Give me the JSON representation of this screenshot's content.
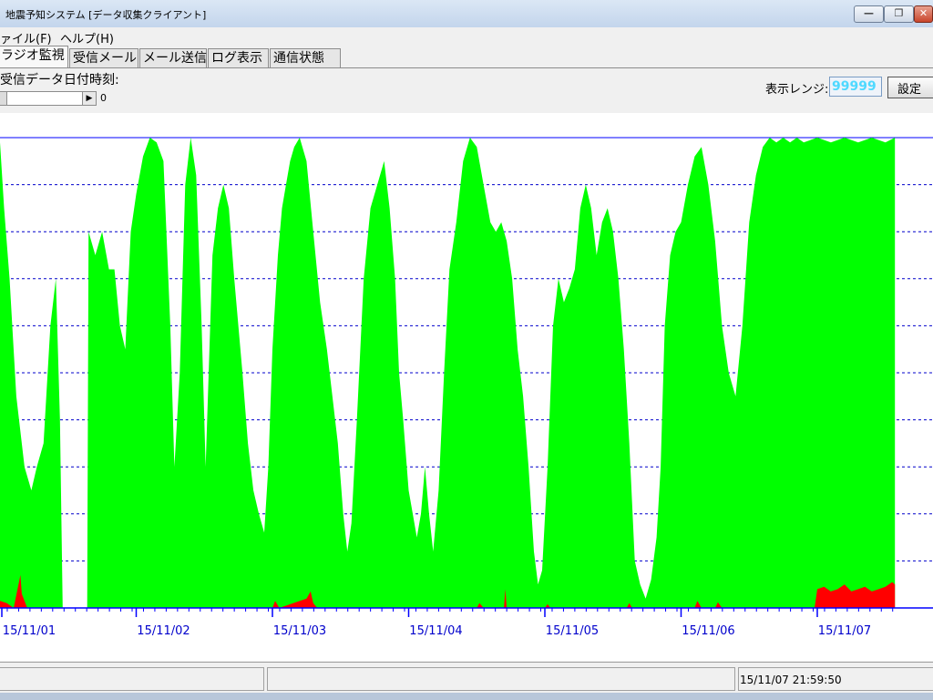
{
  "window": {
    "title": "地震予知システム [データ収集クライアント]",
    "minimize_glyph": "—",
    "restore_glyph": "❐",
    "close_glyph": "✕"
  },
  "menu": {
    "file": "ァイル(F)",
    "help": "ヘルプ(H)"
  },
  "tabs": [
    {
      "label": "ラジオ監視",
      "active": true
    },
    {
      "label": "受信メール",
      "active": false
    },
    {
      "label": "メール送信",
      "active": false
    },
    {
      "label": "ログ表示",
      "active": false
    },
    {
      "label": "通信状態",
      "active": false
    }
  ],
  "controls": {
    "receive_datetime_label": "受信データ日付時刻:",
    "slider_value": "0",
    "range_label": "表示レンジ:",
    "range_value": "99999",
    "set_button": "設定"
  },
  "colors": {
    "signal": "#00ff00",
    "alert": "#ff0000",
    "axis": "#0000ff",
    "grid": "#0000cc"
  },
  "chart_data": {
    "type": "area",
    "x_tick_labels": [
      "15/11/01",
      "15/11/02",
      "15/11/03",
      "15/11/04",
      "15/11/05",
      "15/11/06",
      "15/11/07"
    ],
    "gridline_count": 9,
    "xlim_days": [
      0.97,
      7.57
    ],
    "green_series": [
      [
        0.97,
        0.96
      ],
      [
        1.0,
        0.99
      ],
      [
        1.03,
        0.85
      ],
      [
        1.07,
        0.7
      ],
      [
        1.12,
        0.45
      ],
      [
        1.18,
        0.3
      ],
      [
        1.23,
        0.25
      ],
      [
        1.27,
        0.3
      ],
      [
        1.32,
        0.35
      ],
      [
        1.37,
        0.6
      ],
      [
        1.41,
        0.7
      ],
      [
        1.44,
        0.4
      ],
      [
        1.46,
        0.0
      ],
      [
        1.64,
        0.0
      ],
      [
        1.65,
        0.8
      ],
      [
        1.7,
        0.75
      ],
      [
        1.75,
        0.8
      ],
      [
        1.8,
        0.72
      ],
      [
        1.84,
        0.72
      ],
      [
        1.88,
        0.6
      ],
      [
        1.92,
        0.55
      ],
      [
        1.96,
        0.8
      ],
      [
        2.0,
        0.88
      ],
      [
        2.05,
        0.96
      ],
      [
        2.1,
        1.0
      ],
      [
        2.15,
        0.99
      ],
      [
        2.2,
        0.95
      ],
      [
        2.25,
        0.6
      ],
      [
        2.28,
        0.3
      ],
      [
        2.32,
        0.5
      ],
      [
        2.36,
        0.9
      ],
      [
        2.4,
        1.0
      ],
      [
        2.44,
        0.92
      ],
      [
        2.48,
        0.6
      ],
      [
        2.51,
        0.3
      ],
      [
        2.56,
        0.75
      ],
      [
        2.6,
        0.85
      ],
      [
        2.64,
        0.9
      ],
      [
        2.68,
        0.85
      ],
      [
        2.72,
        0.7
      ],
      [
        2.78,
        0.5
      ],
      [
        2.82,
        0.35
      ],
      [
        2.86,
        0.25
      ],
      [
        2.9,
        0.2
      ],
      [
        2.94,
        0.16
      ],
      [
        2.97,
        0.3
      ],
      [
        3.0,
        0.55
      ],
      [
        3.04,
        0.75
      ],
      [
        3.07,
        0.85
      ],
      [
        3.1,
        0.9
      ],
      [
        3.13,
        0.95
      ],
      [
        3.16,
        0.98
      ],
      [
        3.2,
        1.0
      ],
      [
        3.25,
        0.95
      ],
      [
        3.3,
        0.8
      ],
      [
        3.35,
        0.65
      ],
      [
        3.4,
        0.55
      ],
      [
        3.44,
        0.45
      ],
      [
        3.48,
        0.35
      ],
      [
        3.52,
        0.2
      ],
      [
        3.55,
        0.12
      ],
      [
        3.58,
        0.18
      ],
      [
        3.62,
        0.4
      ],
      [
        3.67,
        0.7
      ],
      [
        3.72,
        0.85
      ],
      [
        3.77,
        0.9
      ],
      [
        3.82,
        0.95
      ],
      [
        3.86,
        0.85
      ],
      [
        3.9,
        0.7
      ],
      [
        3.93,
        0.5
      ],
      [
        3.96,
        0.4
      ],
      [
        4.0,
        0.25
      ],
      [
        4.03,
        0.2
      ],
      [
        4.06,
        0.15
      ],
      [
        4.09,
        0.2
      ],
      [
        4.12,
        0.3
      ],
      [
        4.15,
        0.2
      ],
      [
        4.18,
        0.12
      ],
      [
        4.22,
        0.25
      ],
      [
        4.26,
        0.5
      ],
      [
        4.3,
        0.72
      ],
      [
        4.35,
        0.82
      ],
      [
        4.4,
        0.95
      ],
      [
        4.45,
        1.0
      ],
      [
        4.5,
        0.98
      ],
      [
        4.55,
        0.9
      ],
      [
        4.6,
        0.82
      ],
      [
        4.64,
        0.8
      ],
      [
        4.68,
        0.82
      ],
      [
        4.72,
        0.78
      ],
      [
        4.76,
        0.7
      ],
      [
        4.8,
        0.55
      ],
      [
        4.84,
        0.45
      ],
      [
        4.88,
        0.3
      ],
      [
        4.92,
        0.12
      ],
      [
        4.95,
        0.05
      ],
      [
        4.98,
        0.08
      ],
      [
        5.02,
        0.3
      ],
      [
        5.06,
        0.6
      ],
      [
        5.1,
        0.7
      ],
      [
        5.14,
        0.65
      ],
      [
        5.18,
        0.68
      ],
      [
        5.22,
        0.72
      ],
      [
        5.26,
        0.85
      ],
      [
        5.3,
        0.9
      ],
      [
        5.34,
        0.85
      ],
      [
        5.38,
        0.75
      ],
      [
        5.42,
        0.82
      ],
      [
        5.46,
        0.85
      ],
      [
        5.5,
        0.8
      ],
      [
        5.54,
        0.7
      ],
      [
        5.58,
        0.55
      ],
      [
        5.62,
        0.35
      ],
      [
        5.66,
        0.1
      ],
      [
        5.7,
        0.05
      ],
      [
        5.74,
        0.02
      ],
      [
        5.78,
        0.06
      ],
      [
        5.82,
        0.15
      ],
      [
        5.85,
        0.3
      ],
      [
        5.88,
        0.6
      ],
      [
        5.92,
        0.75
      ],
      [
        5.96,
        0.8
      ],
      [
        6.0,
        0.82
      ],
      [
        6.05,
        0.9
      ],
      [
        6.1,
        0.96
      ],
      [
        6.15,
        0.98
      ],
      [
        6.2,
        0.9
      ],
      [
        6.25,
        0.78
      ],
      [
        6.3,
        0.6
      ],
      [
        6.35,
        0.5
      ],
      [
        6.4,
        0.45
      ],
      [
        6.45,
        0.6
      ],
      [
        6.5,
        0.82
      ],
      [
        6.55,
        0.92
      ],
      [
        6.6,
        0.98
      ],
      [
        6.65,
        1.0
      ],
      [
        6.7,
        0.99
      ],
      [
        6.75,
        1.0
      ],
      [
        6.8,
        0.99
      ],
      [
        6.85,
        1.0
      ],
      [
        6.9,
        0.99
      ],
      [
        7.0,
        1.0
      ],
      [
        7.1,
        0.99
      ],
      [
        7.2,
        1.0
      ],
      [
        7.3,
        0.99
      ],
      [
        7.4,
        1.0
      ],
      [
        7.5,
        0.99
      ],
      [
        7.57,
        1.0
      ]
    ],
    "red_series": [
      [
        0.97,
        0.01
      ],
      [
        1.0,
        0.015
      ],
      [
        1.05,
        0.01
      ],
      [
        1.1,
        0.0
      ],
      [
        1.15,
        0.07
      ],
      [
        1.16,
        0.03
      ],
      [
        1.2,
        0.0
      ],
      [
        3.0,
        0.0
      ],
      [
        3.02,
        0.015
      ],
      [
        3.05,
        0.0
      ],
      [
        3.25,
        0.02
      ],
      [
        3.28,
        0.035
      ],
      [
        3.3,
        0.01
      ],
      [
        3.33,
        0.0
      ],
      [
        4.5,
        0.0
      ],
      [
        4.52,
        0.01
      ],
      [
        4.55,
        0.0
      ],
      [
        4.7,
        0.0
      ],
      [
        4.71,
        0.04
      ],
      [
        4.72,
        0.0
      ],
      [
        5.0,
        0.0
      ],
      [
        5.02,
        0.008
      ],
      [
        5.04,
        0.0
      ],
      [
        5.6,
        0.0
      ],
      [
        5.62,
        0.01
      ],
      [
        5.64,
        0.0
      ],
      [
        6.1,
        0.0
      ],
      [
        6.12,
        0.015
      ],
      [
        6.15,
        0.0
      ],
      [
        6.25,
        0.0
      ],
      [
        6.27,
        0.012
      ],
      [
        6.3,
        0.0
      ],
      [
        6.98,
        0.0
      ],
      [
        7.0,
        0.04
      ],
      [
        7.05,
        0.045
      ],
      [
        7.1,
        0.035
      ],
      [
        7.15,
        0.04
      ],
      [
        7.2,
        0.05
      ],
      [
        7.25,
        0.035
      ],
      [
        7.3,
        0.04
      ],
      [
        7.35,
        0.045
      ],
      [
        7.4,
        0.035
      ],
      [
        7.45,
        0.04
      ],
      [
        7.5,
        0.045
      ],
      [
        7.55,
        0.055
      ],
      [
        7.57,
        0.05
      ]
    ]
  },
  "status": {
    "datetime": "15/11/07 21:59:50"
  }
}
